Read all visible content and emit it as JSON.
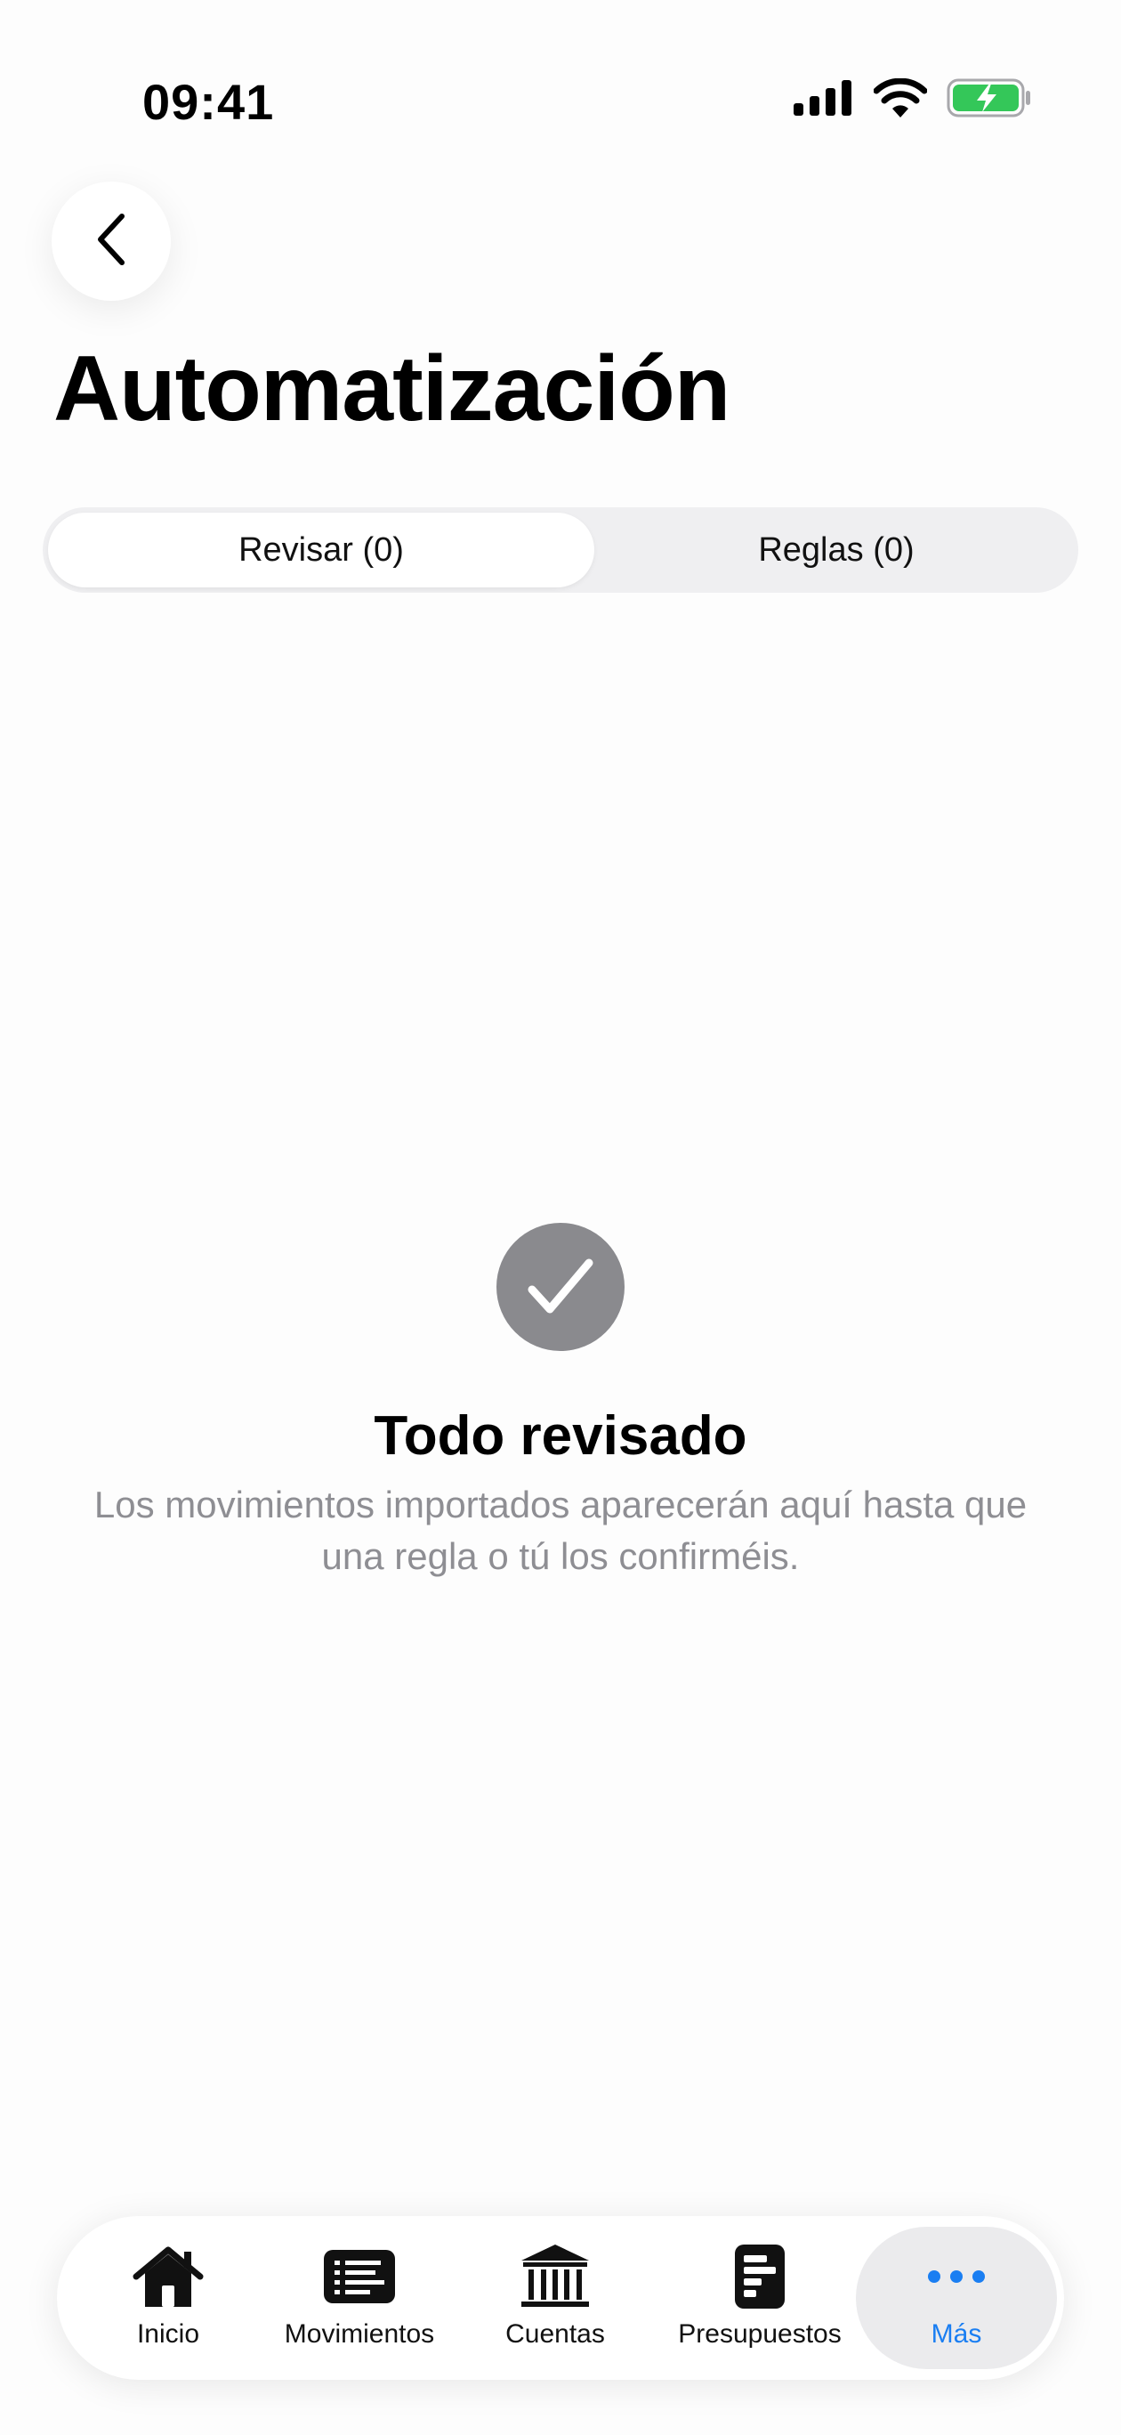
{
  "status_bar": {
    "time": "09:41",
    "icons": [
      "cellular-icon",
      "wifi-icon",
      "battery-charging-icon"
    ],
    "battery_color": "#34c759"
  },
  "nav": {
    "back_icon": "chevron-left-icon"
  },
  "page": {
    "title": "Automatización"
  },
  "segmented": {
    "tabs": [
      {
        "label": "Revisar (0)",
        "selected": true
      },
      {
        "label": "Reglas (0)",
        "selected": false
      }
    ]
  },
  "empty_state": {
    "icon": "checkmark-circle-icon",
    "title": "Todo revisado",
    "description": "Los movimientos importados aparecerán aquí hasta que una regla o tú los confirméis."
  },
  "tab_bar": {
    "accent_color": "#1a7ef2",
    "items": [
      {
        "label": "Inicio",
        "icon": "house-icon",
        "active": false
      },
      {
        "label": "Movimientos",
        "icon": "list-icon",
        "active": false
      },
      {
        "label": "Cuentas",
        "icon": "bank-icon",
        "active": false
      },
      {
        "label": "Presupuestos",
        "icon": "budget-icon",
        "active": false
      },
      {
        "label": "Más",
        "icon": "ellipsis-icon",
        "active": true
      }
    ]
  }
}
